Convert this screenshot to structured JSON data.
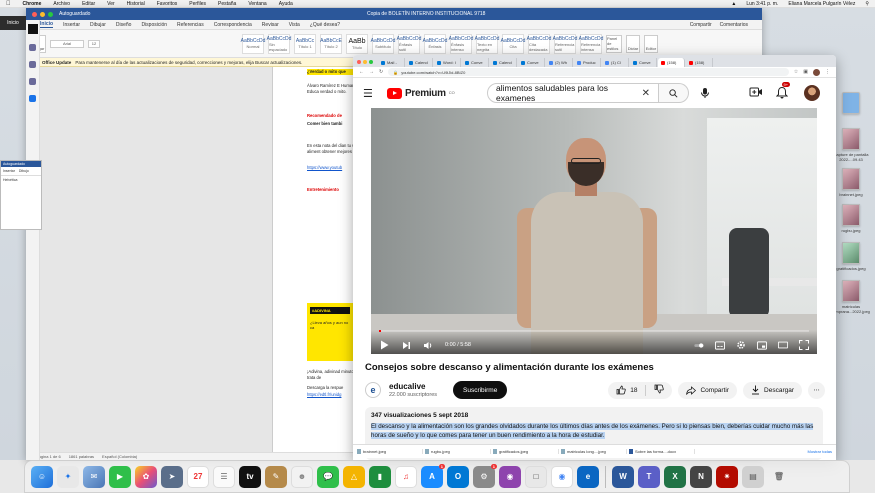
{
  "menubar": {
    "app": "Chrome",
    "items": [
      "Archivo",
      "Editar",
      "Ver",
      "Historial",
      "Favoritos",
      "Perfiles",
      "Pestaña",
      "Ventana",
      "Ayuda"
    ],
    "clock": "Lun 3:41 p. m.",
    "user": "Eliana Marcela Pulgarín Vélez"
  },
  "inicio_label": "Inicio",
  "word": {
    "window_title": "Copia de BOLETÍN INTERNO INSTITUCIONAL 9718",
    "autosave": "Autoguardado",
    "tabs": [
      "Inicio",
      "Insertar",
      "Dibujar",
      "Diseño",
      "Disposición",
      "Referencias",
      "Correspondencia",
      "Revisar",
      "Vista",
      "¿Qué desea?"
    ],
    "share": "Compartir",
    "comments": "Comentarios",
    "font_name": "Arial",
    "font_size": "12",
    "paste_label": "Pegar",
    "styles": [
      {
        "sample": "AaBbCcDd",
        "name": "Normal"
      },
      {
        "sample": "AaBbCcDd",
        "name": "Sin espaciado"
      },
      {
        "sample": "AaBbCc",
        "name": "Título 1"
      },
      {
        "sample": "AaBbCcE",
        "name": "Título 2"
      },
      {
        "sample": "AaBb",
        "name": "Título"
      },
      {
        "sample": "AaBbCcDd",
        "name": "Subtítulo"
      },
      {
        "sample": "AaBbCcDd",
        "name": "Énfasis sutil"
      },
      {
        "sample": "AaBbCcDd",
        "name": "Énfasis"
      },
      {
        "sample": "AaBbCcDd",
        "name": "Énfasis intenso"
      },
      {
        "sample": "AaBbCcDd",
        "name": "Texto en negrita"
      },
      {
        "sample": "AaBbCcDd",
        "name": "Cita"
      },
      {
        "sample": "AaBbCcDd",
        "name": "Cita destacada"
      },
      {
        "sample": "AaBbCcDd",
        "name": "Referencia sutil"
      },
      {
        "sample": "AaBbCcDd",
        "name": "Referencia intensa"
      }
    ],
    "ribbon_right": [
      "Panel de estilos",
      "Dictar",
      "Editor"
    ],
    "update_title": "Office Update",
    "update_text": "Para mantenerse al día de las actualizaciones de seguridad, correcciones y mejoras, elija Buscar actualizaciones.",
    "doc": {
      "yellow_heading": "¿Verdad o mito que",
      "para1": "Álvaro Ramírez E Humanos y Educa verdad o mito.",
      "rec_label": "Recomendado de",
      "rec_title": "Comer bien tambi",
      "para2": "En esta nota del dian tu sueño y aliment obtener mejores resu",
      "link1": "https://www.youtub",
      "ent_label": "Entretenimiento",
      "card_head": "#ADIVINA",
      "card_text": "¿Lleva años y aun no ca",
      "para3": "¡Adivina, adivinad minutos y trata de",
      "para4": "Descarga la respue",
      "link2": "https://edtl.fr/unidg"
    },
    "status": [
      "Página 1 de 6",
      "1861 palabras",
      "Español (Colombia)"
    ]
  },
  "mini_doc": {
    "title": "Autoguardado",
    "tabs": [
      "Insertar",
      "Dibujo"
    ],
    "field": "Helvética"
  },
  "chrome": {
    "tabs": [
      {
        "label": "Mail - ",
        "icon": "o"
      },
      {
        "label": "Calend",
        "icon": "o"
      },
      {
        "label": "Word: I",
        "icon": "o"
      },
      {
        "label": "Conve",
        "icon": "o"
      },
      {
        "label": "Calend",
        "icon": "o"
      },
      {
        "label": "Conve",
        "icon": "o"
      },
      {
        "label": "(2) Wh",
        "icon": "g"
      },
      {
        "label": "Produc",
        "icon": "g"
      },
      {
        "label": "(1) Cl",
        "icon": "g"
      },
      {
        "label": "Conve",
        "icon": "o"
      },
      {
        "label": "(158) ",
        "icon": "yt",
        "active": true
      },
      {
        "label": "(158) ",
        "icon": "yt"
      }
    ],
    "url": "youtube.com/watch?v=U9lJld-8BIZ0"
  },
  "youtube": {
    "logo_text": "Premium",
    "logo_sup": "CO",
    "search_value": "alimentos saludables para los examenes",
    "notif_count": "9+",
    "time": "0:00 / 5:58",
    "progress": 0.005,
    "title": "Consejos sobre descanso y alimentación durante los exámenes",
    "channel_name": "educalive",
    "channel_initial": "e",
    "subscribers": "22.000 suscriptores",
    "subscribe_label": "Suscribirme",
    "likes": "18",
    "share_label": "Compartir",
    "download_label": "Descargar",
    "desc_meta": "347 visualizaciones  5 sept 2018",
    "desc_text": "El descanso y la alimentación son los grandes olvidados durante los últimos días antes de los exámenes. Pero si lo piensas bien, deberías cuidar mucho más las horas de sueño y lo que comes para tener un buen rendimiento a la hora de estudiar."
  },
  "downloads": {
    "items": [
      "brainnet.jpeg",
      "rugbu.jpeg",
      "gratificados.jpeg",
      "matriculas long....jpeg",
      "Sobre las forma....docx"
    ],
    "show_all": "Mostrar todas"
  },
  "desktop_icons": [
    {
      "label": "Capture de pantalla 2022-...09.43"
    },
    {
      "label": "brainnet.jpeg"
    },
    {
      "label": "rugbu.jpeg"
    },
    {
      "label": "gratificados.jpeg"
    },
    {
      "label": "matriculas temprana...2022.jpeg"
    }
  ],
  "dock_calendar_day": "27",
  "dock_badges": {
    "appstore": "1",
    "settings": "1"
  }
}
